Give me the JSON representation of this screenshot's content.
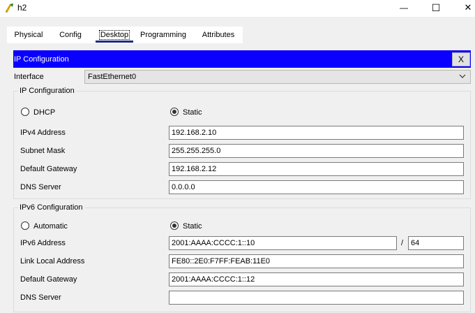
{
  "window": {
    "title": "h2",
    "minimize_glyph": "—",
    "maximize_glyph": "☐",
    "close_glyph": "✕"
  },
  "tabs": [
    {
      "label": "Physical"
    },
    {
      "label": "Config"
    },
    {
      "label": "Desktop",
      "selected": true
    },
    {
      "label": "Programming"
    },
    {
      "label": "Attributes"
    }
  ],
  "dialog": {
    "title": "IP Configuration",
    "close_label": "X",
    "header_color": "#0a00ff"
  },
  "interface": {
    "label": "Interface",
    "value": "FastEthernet0"
  },
  "ipv4": {
    "group_title": "IP Configuration",
    "dhcp_label": "DHCP",
    "static_label": "Static",
    "mode": "Static",
    "address_label": "IPv4 Address",
    "address": "192.168.2.10",
    "mask_label": "Subnet Mask",
    "mask": "255.255.255.0",
    "gateway_label": "Default Gateway",
    "gateway": "192.168.2.12",
    "dns_label": "DNS Server",
    "dns": "0.0.0.0"
  },
  "ipv6": {
    "group_title": "IPv6 Configuration",
    "auto_label": "Automatic",
    "static_label": "Static",
    "mode": "Static",
    "address_label": "IPv6 Address",
    "address": "2001:AAAA:CCCC:1::10",
    "prefix_separator": "/",
    "prefix": "64",
    "link_local_label": "Link Local Address",
    "link_local": "FE80::2E0:F7FF:FEAB:11E0",
    "gateway_label": "Default Gateway",
    "gateway": "2001:AAAA:CCCC:1::12",
    "dns_label": "DNS Server",
    "dns": ""
  }
}
